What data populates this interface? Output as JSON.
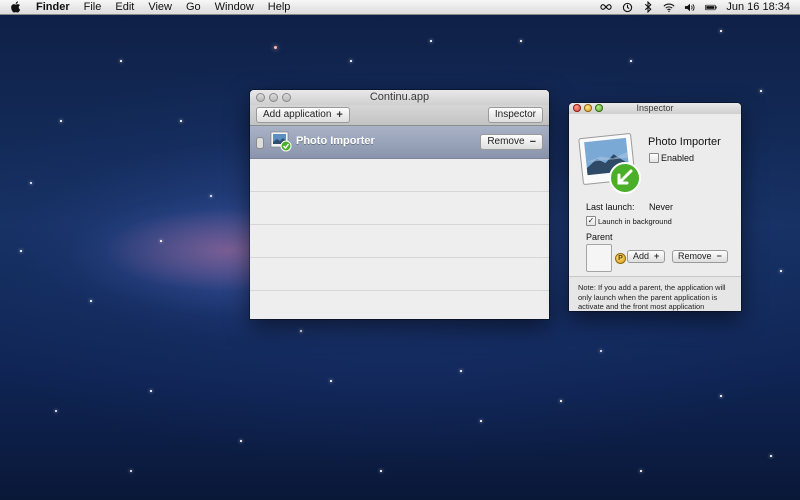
{
  "menubar": {
    "app_name": "Finder",
    "items": [
      "File",
      "Edit",
      "View",
      "Go",
      "Window",
      "Help"
    ],
    "status_icons": [
      "infinity-icon",
      "time-machine-icon",
      "bluetooth-icon",
      "wifi-icon",
      "volume-icon",
      "battery-icon"
    ],
    "clock": "Jun 16  18:34"
  },
  "main_window": {
    "title": "Continu.app",
    "add_button": "Add application",
    "inspector_button": "Inspector",
    "apps": [
      {
        "name": "Photo Importer",
        "remove_label": "Remove",
        "selected": true
      }
    ]
  },
  "inspector": {
    "title": "Inspector",
    "app_name": "Photo Importer",
    "enabled_label": "Enabled",
    "enabled_checked": false,
    "last_launch_label": "Last launch:",
    "last_launch_value": "Never",
    "launch_bg_label": "Launch in background",
    "launch_bg_checked": true,
    "parent_label": "Parent",
    "parent_badge": "P",
    "add_label": "Add",
    "remove_label": "Remove",
    "note": "Note: If you add a parent, the application will only launch when the parent application is activate and the front most application"
  },
  "colors": {
    "selection": "#8a95ad",
    "check_green": "#4caf2a",
    "wallpaper": "#163163"
  }
}
